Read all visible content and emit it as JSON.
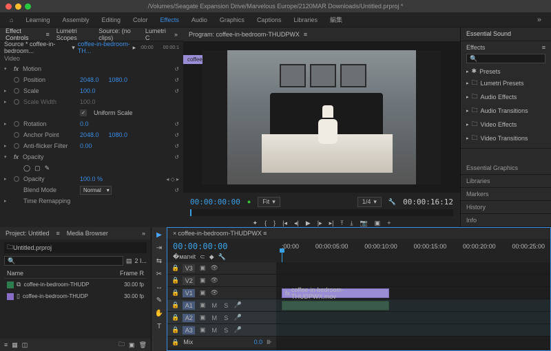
{
  "title": "/Volumes/Seagate Expansion Drive/Marvelous Europe/2120MAR Downloads/Untitled.prproj *",
  "workspaces": [
    "Learning",
    "Assembly",
    "Editing",
    "Color",
    "Effects",
    "Audio",
    "Graphics",
    "Captions",
    "Libraries",
    "編集"
  ],
  "workspaceActiveIndex": 4,
  "effectControls": {
    "tabs": [
      "Effect Controls",
      "Lumetri Scopes",
      "Source: (no clips)",
      "Lumetri C"
    ],
    "sourceCrumb": "Source * coffee-in-bedroom...",
    "clipCrumb": "coffee-in-bedroom-TH...",
    "tlStart": ":00:00",
    "tlEnd": "00:00:1",
    "label": "Video",
    "motion": {
      "header": "Motion",
      "position": {
        "name": "Position",
        "x": "2048.0",
        "y": "1080.0"
      },
      "scale": {
        "name": "Scale",
        "val": "100.0"
      },
      "scaleWidth": {
        "name": "Scale Width",
        "val": "100.0"
      },
      "uniform": {
        "label": "Uniform Scale",
        "checked": true
      },
      "rotation": {
        "name": "Rotation",
        "val": "0.0"
      },
      "anchor": {
        "name": "Anchor Point",
        "x": "2048.0",
        "y": "1080.0"
      },
      "flicker": {
        "name": "Anti-flicker Filter",
        "val": "0.00"
      }
    },
    "opacity": {
      "header": "Opacity",
      "value": {
        "name": "Opacity",
        "val": "100.0 %"
      },
      "blend": {
        "name": "Blend Mode",
        "val": "Normal"
      }
    },
    "timeRemap": "Time Remapping"
  },
  "program": {
    "title": "Program: coffee-in-bedroom-THUDPWX",
    "clipTag": "coffee-in-bedroom-",
    "tcIn": "00:00:00:00",
    "fit": "Fit",
    "zoom": "1/4",
    "tcOut": "00:00:16:12"
  },
  "right": {
    "essentialSound": "Essential Sound",
    "effects": {
      "title": "Effects",
      "folders": [
        "Presets",
        "Lumetri Presets",
        "Audio Effects",
        "Audio Transitions",
        "Video Effects",
        "Video Transitions"
      ]
    },
    "items": [
      "Essential Graphics",
      "Libraries",
      "Markers",
      "History",
      "Info"
    ]
  },
  "project": {
    "tabs": [
      "Project: Untitled",
      "Media Browser"
    ],
    "bin": "Untitled.prproj",
    "filter": "2 I...",
    "cols": [
      "Name",
      "Frame R"
    ],
    "rows": [
      {
        "color": "#2e7d4e",
        "name": "coffee-in-bedroom-THUDP",
        "rate": "30.00 fp"
      },
      {
        "color": "#8a6dc6",
        "name": "coffee-in-bedroom-THUDP",
        "rate": "30.00 fp"
      }
    ]
  },
  "timeline": {
    "title": "coffee-in-bedroom-THUDPWX",
    "tc": "00:00:00:00",
    "ticks": [
      ":00:00",
      "00:00:05:00",
      "00:00:10:00",
      "00:00:15:00",
      "00:00:20:00",
      "00:00:25:00"
    ],
    "vtracks": [
      "V3",
      "V2",
      "V1"
    ],
    "atracks": [
      "A1",
      "A2",
      "A3"
    ],
    "clipName": "coffee-in-bedroom-THUDPWX.mov",
    "mix": {
      "label": "Mix",
      "val": "0.0"
    }
  }
}
